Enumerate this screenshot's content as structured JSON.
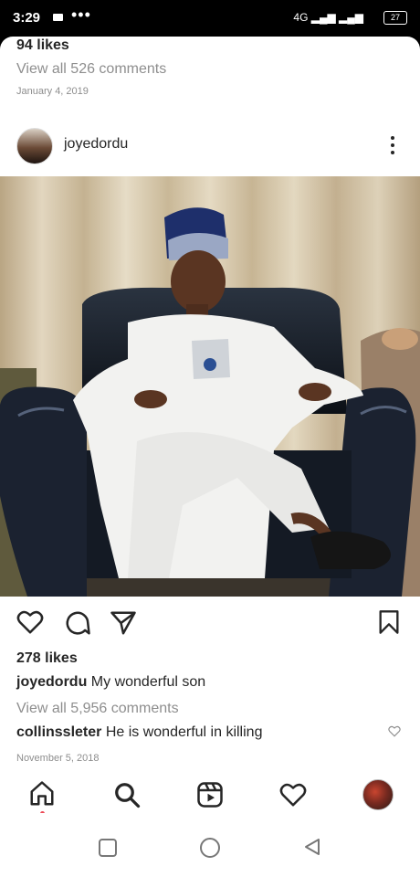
{
  "status_bar": {
    "time": "3:29",
    "network": "4G",
    "battery": "27"
  },
  "prev_post": {
    "likes": "94 likes",
    "view_comments": "View all 526 comments",
    "date": "January 4, 2019"
  },
  "post": {
    "username": "joyedordu",
    "likes": "278 likes",
    "caption_user": "joyedordu",
    "caption": "My wonderful son",
    "view_comments": "View all 5,956 comments",
    "comment_user": "collinssleter",
    "comment": "He is wonderful in killing",
    "date": "November 5, 2018"
  },
  "icons": {
    "post_actions": [
      "heart-icon",
      "comment-icon",
      "share-icon",
      "bookmark-icon"
    ],
    "bottom_nav": [
      "home-icon",
      "search-icon",
      "reels-icon",
      "activity-heart-icon",
      "profile-avatar"
    ],
    "system_nav": [
      "recent-apps-icon",
      "home-circle-icon",
      "back-icon"
    ]
  }
}
